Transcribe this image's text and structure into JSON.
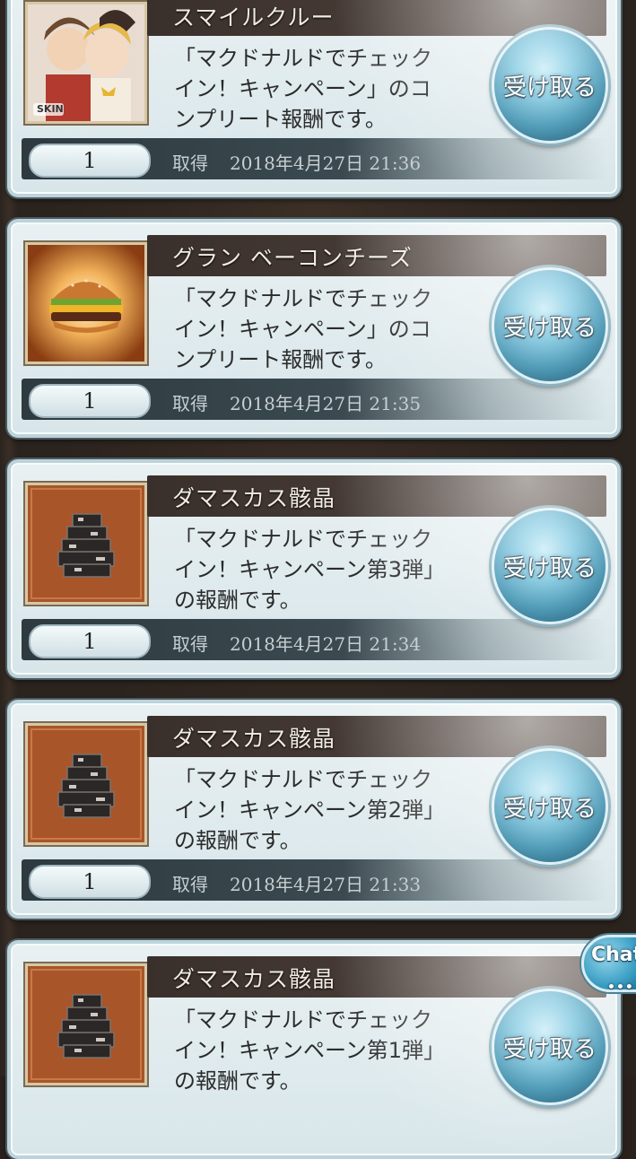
{
  "items": [
    {
      "name": "スマイルクルー",
      "thumb": "skin-character",
      "thumb_badge": "SKIN",
      "desc": [
        "「マクドナルドでチェック",
        "イン！キャンペーン」のコ",
        "ンプリート報酬です。"
      ],
      "qty": "1",
      "acq_label": "取得",
      "acq_time": "2018年4月27日 21:36",
      "button": "受け取る"
    },
    {
      "name": "グラン ベーコンチーズ",
      "thumb": "burger",
      "thumb_badge": "",
      "desc": [
        "「マクドナルドでチェック",
        "イン！キャンペーン」のコ",
        "ンプリート報酬です。"
      ],
      "qty": "1",
      "acq_label": "取得",
      "acq_time": "2018年4月27日 21:35",
      "button": "受け取る"
    },
    {
      "name": "ダマスカス骸晶",
      "thumb": "damascus-crystal",
      "thumb_badge": "",
      "desc": [
        "「マクドナルドでチェック",
        "イン！キャンペーン第3弾」",
        "の報酬です。"
      ],
      "qty": "1",
      "acq_label": "取得",
      "acq_time": "2018年4月27日 21:34",
      "button": "受け取る"
    },
    {
      "name": "ダマスカス骸晶",
      "thumb": "damascus-crystal",
      "thumb_badge": "",
      "desc": [
        "「マクドナルドでチェック",
        "イン！キャンペーン第2弾」",
        "の報酬です。"
      ],
      "qty": "1",
      "acq_label": "取得",
      "acq_time": "2018年4月27日 21:33",
      "button": "受け取る"
    },
    {
      "name": "ダマスカス骸晶",
      "thumb": "damascus-crystal",
      "thumb_badge": "",
      "desc": [
        "「マクドナルドでチェック",
        "イン！キャンペーン第1弾」",
        "の報酬です。"
      ],
      "qty": "",
      "acq_label": "",
      "acq_time": "",
      "button": "受け取る"
    }
  ],
  "chat": {
    "label": "Chat",
    "dots": "•••"
  },
  "colors": {
    "button_blue": "#2b86a8",
    "name_bar": "#3a302b",
    "card_bg": "#dde9ec"
  }
}
